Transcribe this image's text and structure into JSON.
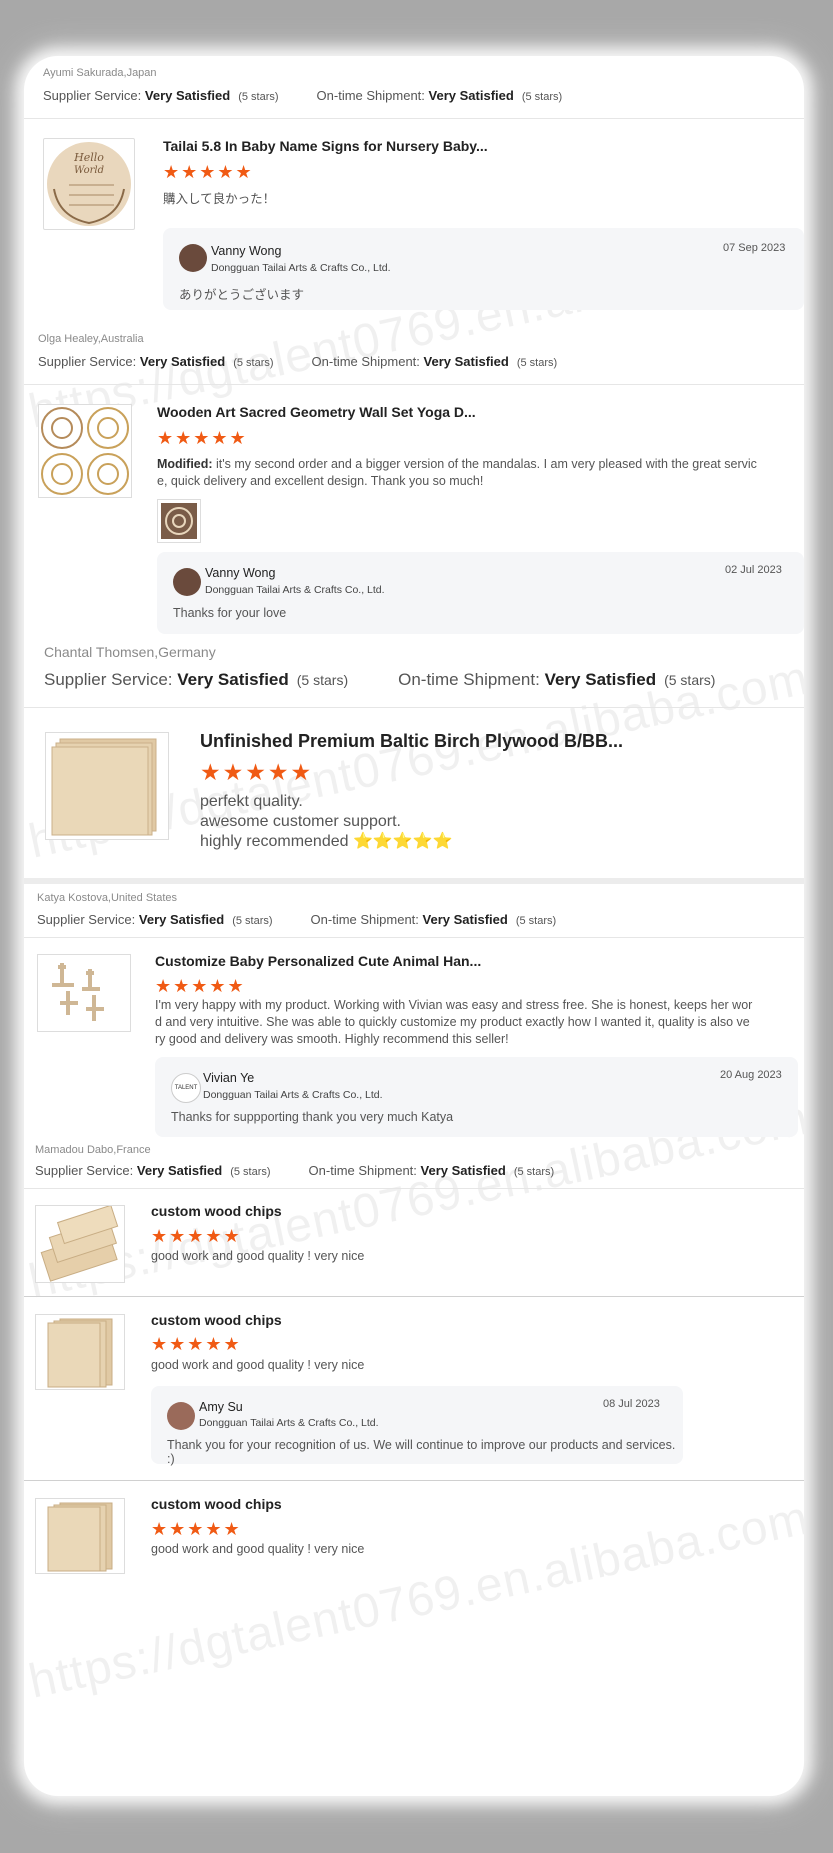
{
  "watermark": "https://dgtalent0769.en.alibaba.com/",
  "labels": {
    "supplier_service": "Supplier Service:",
    "ontime_shipment": "On-time Shipment:",
    "satisfied": "Very Satisfied",
    "five_stars": "(5 stars)",
    "modified": "Modified:"
  },
  "reviews": [
    {
      "reviewer": "Ayumi Sakurada,Japan",
      "product": "Tailai 5.8 In Baby Name Signs for Nursery Baby...",
      "rating": 5,
      "text": "購入して良かった！",
      "reply": {
        "name": "Vanny Wong",
        "company": "Dongguan Tailai Arts & Crafts Co., Ltd.",
        "date": "07 Sep 2023",
        "message": "ありがとうございます"
      }
    },
    {
      "reviewer": "Olga Healey,Australia",
      "product": "Wooden Art Sacred Geometry Wall Set Yoga D...",
      "rating": 5,
      "text_line1": "it's my second order and a bigger version of the mandalas. I am very pleased with the great servic",
      "text_line2": "e, quick delivery and excellent design. Thank you so much!",
      "reply": {
        "name": "Vanny Wong",
        "company": "Dongguan Tailai Arts & Crafts Co., Ltd.",
        "date": "02 Jul 2023",
        "message": "Thanks for your love"
      }
    },
    {
      "reviewer": "Chantal Thomsen,Germany",
      "product": "Unfinished Premium Baltic Birch Plywood B/BB...",
      "rating": 5,
      "text_line1": "perfekt quality.",
      "text_line2": "awesome customer support.",
      "text_line3": "highly recommended",
      "emoji_stars": "⭐⭐⭐⭐⭐"
    },
    {
      "reviewer": "Katya Kostova,United States",
      "product": "Customize Baby Personalized Cute Animal Han...",
      "rating": 5,
      "text_line1": "I'm very happy with my product. Working with Vivian was easy and stress free. She is honest, keeps her wor",
      "text_line2": "d and very intuitive. She was able to quickly customize my product exactly how I wanted it, quality is also ve",
      "text_line3": "ry good and delivery was smooth. Highly recommend this seller!",
      "reply": {
        "name": "Vivian Ye",
        "company": "Dongguan Tailai Arts & Crafts Co., Ltd.",
        "date": "20 Aug 2023",
        "message": "Thanks for suppporting  thank you very much  Katya",
        "avatar_text": "TALENT"
      }
    },
    {
      "reviewer": "Mamadou Dabo,France",
      "items": [
        {
          "product": "custom wood chips",
          "rating": 5,
          "text": "good work and good quality ! very nice"
        },
        {
          "product": "custom wood chips",
          "rating": 5,
          "text": "good work and good quality ! very nice",
          "reply": {
            "name": "Amy Su",
            "company": "Dongguan Tailai Arts & Crafts Co., Ltd.",
            "date": "08 Jul 2023",
            "message": "Thank you for your recognition of us. We will continue to improve our products and services. :)"
          }
        },
        {
          "product": "custom wood chips",
          "rating": 5,
          "text": "good work and good quality ! very nice"
        }
      ]
    }
  ]
}
